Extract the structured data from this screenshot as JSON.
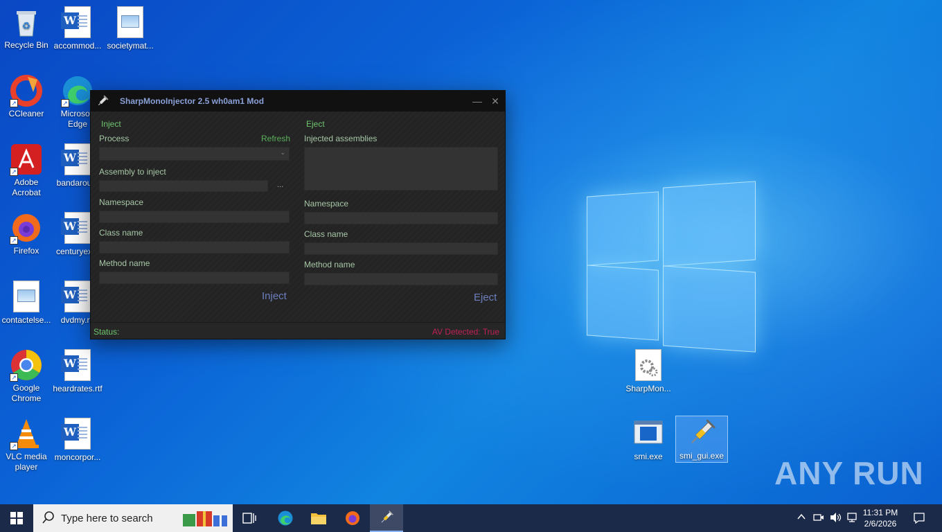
{
  "desktop": {
    "icons_left": [
      {
        "label": "Recycle Bin",
        "icon": "recycle-bin-icon"
      },
      {
        "label": "CCleaner",
        "icon": "ccleaner-icon"
      },
      {
        "label": "Adobe Acrobat",
        "icon": "adobe-acrobat-icon"
      },
      {
        "label": "Firefox",
        "icon": "firefox-icon"
      },
      {
        "label": "contactelse...",
        "icon": "image-file-icon"
      },
      {
        "label": "Google Chrome",
        "icon": "chrome-icon"
      },
      {
        "label": "VLC media player",
        "icon": "vlc-icon"
      }
    ],
    "icons_col2": [
      {
        "label": "accommod...",
        "icon": "word-doc-icon"
      },
      {
        "label": "Microsoft Edge",
        "icon": "edge-icon"
      },
      {
        "label": "bandarou...",
        "icon": "word-doc-icon"
      },
      {
        "label": "centuryex...",
        "icon": "word-doc-icon"
      },
      {
        "label": "dvdmy.rtf",
        "icon": "word-doc-icon"
      },
      {
        "label": "heardrates.rtf",
        "icon": "word-doc-icon"
      },
      {
        "label": "moncorpor...",
        "icon": "word-doc-icon"
      }
    ],
    "icon_col3": {
      "label": "societymat...",
      "icon": "image-file-icon"
    },
    "icons_right": [
      {
        "label": "SharpMon...",
        "icon": "settings-file-icon"
      },
      {
        "label": "smi.exe",
        "icon": "exe-window-icon"
      },
      {
        "label": "smi_gui.exe",
        "icon": "syringe-icon"
      }
    ]
  },
  "window": {
    "title": "SharpMonoInjector 2.5 wh0am1 Mod",
    "inject": {
      "section": "Inject",
      "process_label": "Process",
      "refresh": "Refresh",
      "process_value": "",
      "assembly_label": "Assembly to inject",
      "browse": "...",
      "namespace_label": "Namespace",
      "classname_label": "Class name",
      "method_label": "Method name",
      "button": "Inject"
    },
    "eject": {
      "section": "Eject",
      "assemblies_label": "Injected assemblies",
      "namespace_label": "Namespace",
      "classname_label": "Class name",
      "method_label": "Method name",
      "button": "Eject"
    },
    "status_label": "Status:",
    "av_status": "AV Detected: True"
  },
  "taskbar": {
    "search_placeholder": "Type here to search",
    "time": "11:31 PM",
    "date": "2/6/2026"
  },
  "watermark": "ANY RUN"
}
